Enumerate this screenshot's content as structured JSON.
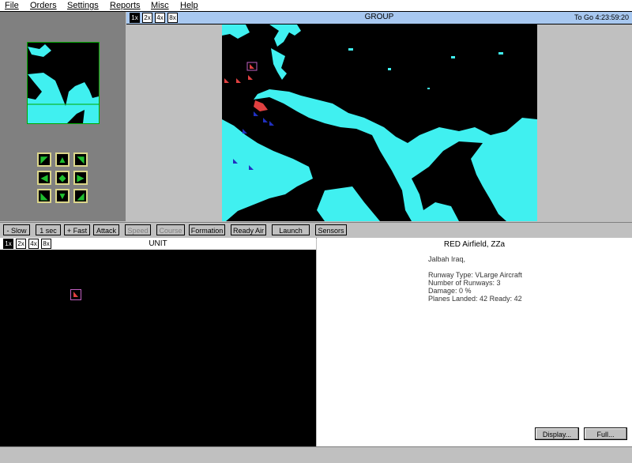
{
  "menu": [
    {
      "label": "File"
    },
    {
      "label": "Orders"
    },
    {
      "label": "Settings"
    },
    {
      "label": "Reports"
    },
    {
      "label": "Misc"
    },
    {
      "label": "Help"
    }
  ],
  "group_map": {
    "title": "GROUP",
    "clock": "To Go 4:23:59:20",
    "zoom": [
      "1x",
      "2x",
      "4x",
      "8x"
    ],
    "active_zoom": "1x"
  },
  "navpad": {
    "arrows": [
      "◤",
      "▲",
      "◥",
      "◀",
      "◆",
      "▶",
      "◣",
      "▼",
      "◢"
    ]
  },
  "toolbar": {
    "slow": "- Slow",
    "speed": "1 sec",
    "fast": "+ Fast",
    "attack": "Attack",
    "speed_btn": "Speed",
    "course": "Course",
    "formation": "Formation",
    "ready_air": "Ready Air",
    "launch": "Launch",
    "sensors": "Sensors"
  },
  "unit_map": {
    "title": "UNIT",
    "zoom": [
      "1x",
      "2x",
      "4x",
      "8x"
    ]
  },
  "info": {
    "title": "RED Airfield, ZZa",
    "location": "Jalbah Iraq,",
    "runway_type": "Runway Type: VLarge Aircraft",
    "num_runways": "Number of Runways: 3",
    "damage": "Damage: 0 %",
    "planes": "Planes Landed: 42  Ready: 42",
    "display_button": "Display...",
    "full_button": "Full..."
  },
  "colors": {
    "land": "#40f0f0",
    "sea": "#000000",
    "red_side": "#e04040",
    "blue_side": "#2030c0",
    "title_bar": "#a8c8f0"
  }
}
